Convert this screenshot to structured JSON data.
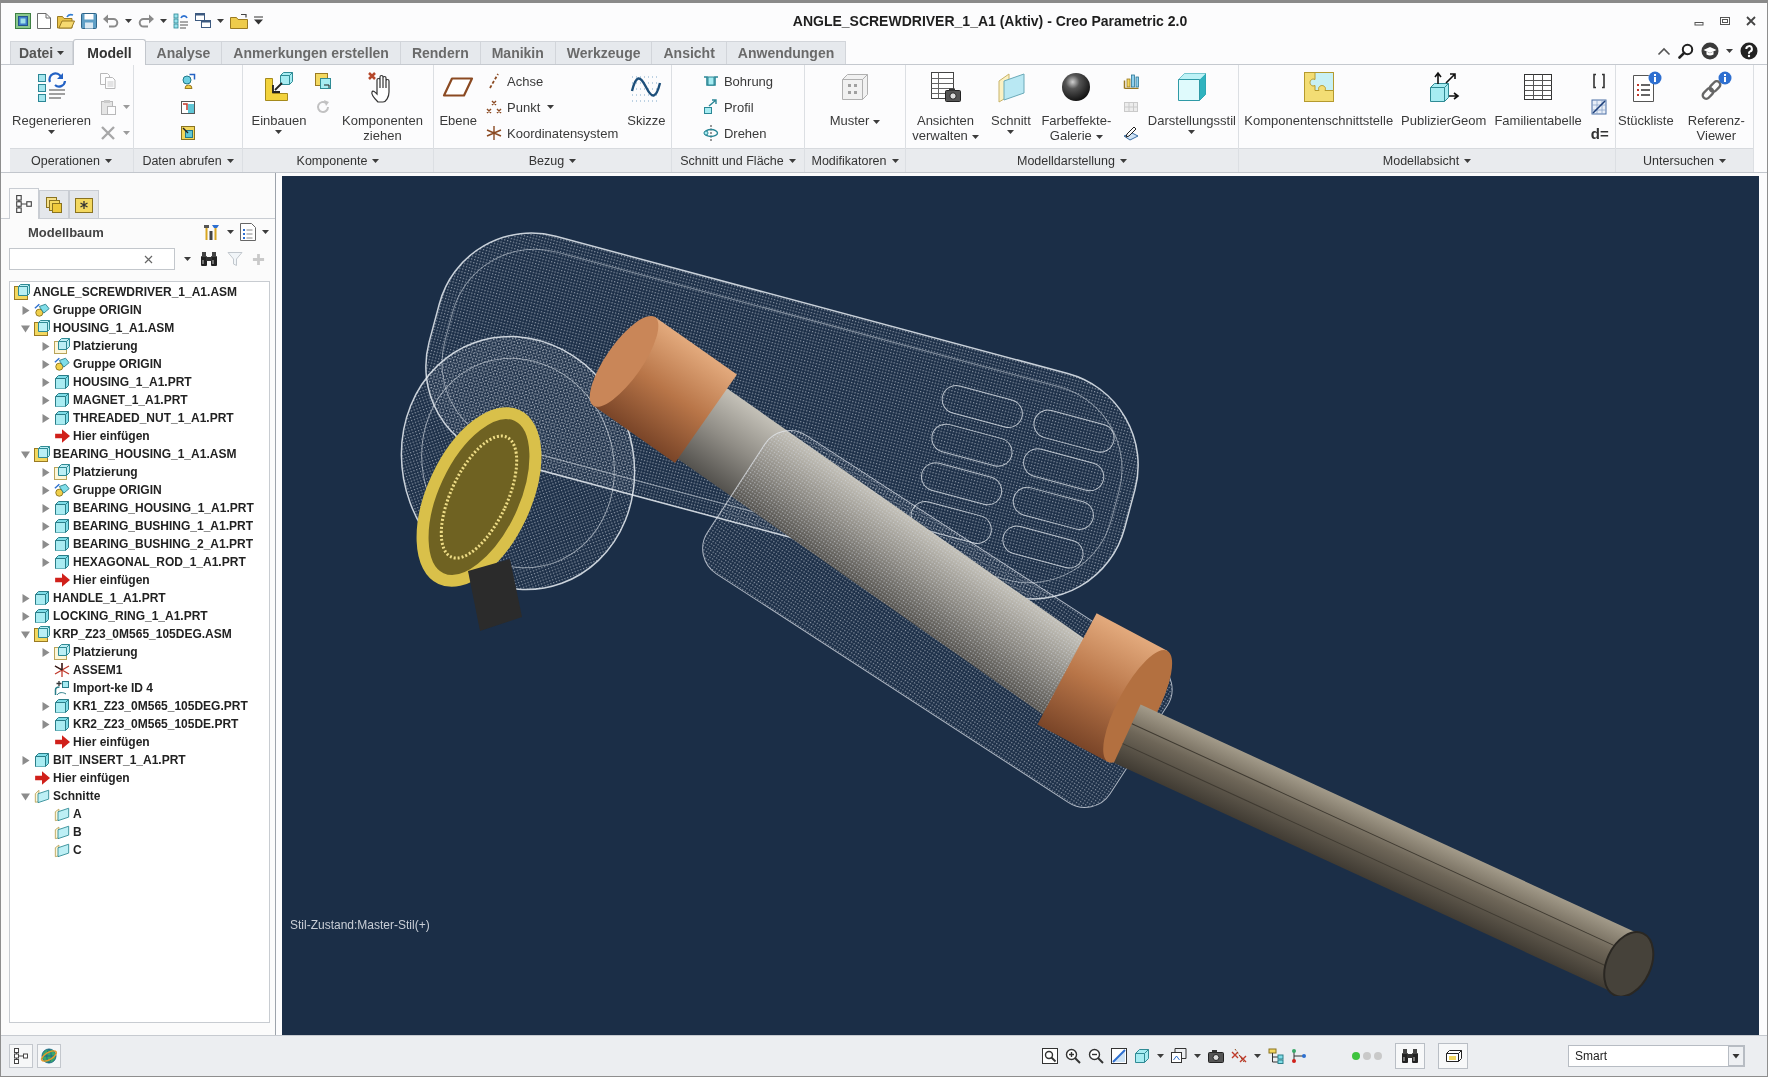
{
  "window": {
    "title": "ANGLE_SCREWDRIVER_1_A1 (Aktiv) - Creo Parametric 2.0"
  },
  "tabs": [
    {
      "label": "Datei",
      "kind": "file",
      "selected": false
    },
    {
      "label": "Modell",
      "kind": "tab",
      "selected": true
    },
    {
      "label": "Analyse",
      "kind": "tab",
      "selected": false
    },
    {
      "label": "Anmerkungen erstellen",
      "kind": "tab",
      "selected": false
    },
    {
      "label": "Rendern",
      "kind": "tab",
      "selected": false
    },
    {
      "label": "Manikin",
      "kind": "tab",
      "selected": false
    },
    {
      "label": "Werkzeuge",
      "kind": "tab",
      "selected": false
    },
    {
      "label": "Ansicht",
      "kind": "tab",
      "selected": false
    },
    {
      "label": "Anwendungen",
      "kind": "tab",
      "selected": false
    }
  ],
  "ribbon": {
    "groups": [
      {
        "label": "Operationen",
        "items": [
          {
            "kind": "split",
            "label": "Regenerieren"
          },
          {
            "kind": "stack",
            "items": [
              {
                "kind": "icon",
                "disabled": true
              },
              {
                "kind": "icon",
                "disabled": true,
                "dropdown": true
              },
              {
                "kind": "icon",
                "disabled": true,
                "dropdown": true
              }
            ]
          }
        ]
      },
      {
        "label": "Daten abrufen",
        "items": [
          {
            "kind": "stack",
            "items": [
              {
                "kind": "icon",
                "disabled": false
              },
              {
                "kind": "icon",
                "disabled": false
              },
              {
                "kind": "icon",
                "disabled": false
              }
            ]
          }
        ]
      },
      {
        "label": "Komponente",
        "items": [
          {
            "kind": "split",
            "label": "Einbauen"
          },
          {
            "kind": "stack",
            "items": [
              {
                "kind": "icon",
                "disabled": false
              },
              {
                "kind": "icon",
                "disabled": true
              }
            ]
          },
          {
            "kind": "large",
            "label": "Komponenten ziehen"
          }
        ]
      },
      {
        "label": "Bezug",
        "items": [
          {
            "kind": "large",
            "label": "Ebene"
          },
          {
            "kind": "stack",
            "items": [
              {
                "kind": "small",
                "label": "Achse"
              },
              {
                "kind": "small",
                "label": "Punkt",
                "dropdown": true
              },
              {
                "kind": "small",
                "label": "Koordinatensystem"
              }
            ]
          },
          {
            "kind": "large",
            "label": "Skizze"
          }
        ]
      },
      {
        "label": "Schnitt und Fläche",
        "items": [
          {
            "kind": "stack",
            "items": [
              {
                "kind": "small",
                "label": "Bohrung"
              },
              {
                "kind": "small",
                "label": "Profil"
              },
              {
                "kind": "small",
                "label": "Drehen"
              }
            ]
          }
        ]
      },
      {
        "label": "Modifikatoren",
        "items": [
          {
            "kind": "menu",
            "label": "Muster"
          }
        ]
      },
      {
        "label": "Modelldarstellung",
        "items": [
          {
            "kind": "menu",
            "label": "Ansichten verwalten"
          },
          {
            "kind": "split",
            "label": "Schnitt"
          },
          {
            "kind": "menu",
            "label": "Farbeffekte-Galerie"
          },
          {
            "kind": "stack",
            "items": [
              {
                "kind": "icon",
                "disabled": false
              },
              {
                "kind": "icon",
                "disabled": true
              },
              {
                "kind": "icon",
                "disabled": false
              }
            ]
          },
          {
            "kind": "split",
            "label": "Darstellungsstil"
          }
        ]
      },
      {
        "label": "Modellabsicht",
        "items": [
          {
            "kind": "large",
            "label": "Komponentenschnittstelle"
          },
          {
            "kind": "large",
            "label": "PublizierGeom"
          },
          {
            "kind": "large",
            "label": "Familientabelle"
          },
          {
            "kind": "stack",
            "items": [
              {
                "kind": "icon",
                "disabled": false
              },
              {
                "kind": "icon",
                "disabled": false
              },
              {
                "kind": "glyph",
                "label": "d="
              }
            ]
          }
        ]
      },
      {
        "label": "Untersuchen",
        "items": [
          {
            "kind": "large",
            "label": "Stückliste"
          },
          {
            "kind": "large",
            "label": "Referenz-Viewer"
          }
        ]
      }
    ]
  },
  "navigator": {
    "tabs": [
      {
        "selected": true
      },
      {
        "selected": false
      },
      {
        "selected": false
      }
    ],
    "title": "Modellbaum",
    "search_tools": [
      {
        "disabled": false
      },
      {
        "disabled": true
      },
      {
        "disabled": true
      }
    ],
    "tree": [
      {
        "label": "ANGLE_SCREWDRIVER_1_A1.ASM",
        "kind": "asm",
        "children": [
          {
            "label": "Gruppe ORIGIN",
            "kind": "group",
            "expanded": false
          },
          {
            "label": "HOUSING_1_A1.ASM",
            "kind": "asm",
            "expanded": true,
            "children": [
              {
                "label": "Platzierung",
                "kind": "placement",
                "expanded": false
              },
              {
                "label": "Gruppe ORIGIN",
                "kind": "group",
                "expanded": false
              },
              {
                "label": "HOUSING_1_A1.PRT",
                "kind": "prt",
                "expanded": false
              },
              {
                "label": "MAGNET_1_A1.PRT",
                "kind": "prt",
                "expanded": false
              },
              {
                "label": "THREADED_NUT_1_A1.PRT",
                "kind": "prt",
                "expanded": false
              },
              {
                "label": "Hier einfügen",
                "kind": "insert"
              }
            ]
          },
          {
            "label": "BEARING_HOUSING_1_A1.ASM",
            "kind": "asm",
            "expanded": true,
            "children": [
              {
                "label": "Platzierung",
                "kind": "placement",
                "expanded": false
              },
              {
                "label": "Gruppe ORIGIN",
                "kind": "group",
                "expanded": false
              },
              {
                "label": "BEARING_HOUSING_1_A1.PRT",
                "kind": "prt",
                "expanded": false
              },
              {
                "label": "BEARING_BUSHING_1_A1.PRT",
                "kind": "prt",
                "expanded": false
              },
              {
                "label": "BEARING_BUSHING_2_A1.PRT",
                "kind": "prt",
                "expanded": false
              },
              {
                "label": "HEXAGONAL_ROD_1_A1.PRT",
                "kind": "prt",
                "expanded": false
              },
              {
                "label": "Hier einfügen",
                "kind": "insert"
              }
            ]
          },
          {
            "label": "HANDLE_1_A1.PRT",
            "kind": "prt",
            "expanded": false
          },
          {
            "label": "LOCKING_RING_1_A1.PRT",
            "kind": "prt",
            "expanded": false
          },
          {
            "label": "KRP_Z23_0M565_105DEG.ASM",
            "kind": "asm",
            "expanded": true,
            "children": [
              {
                "label": "Platzierung",
                "kind": "placement",
                "expanded": false
              },
              {
                "label": "ASSEM1",
                "kind": "csys"
              },
              {
                "label": "Import-ke ID 4",
                "kind": "import"
              },
              {
                "label": "KR1_Z23_0M565_105DEG.PRT",
                "kind": "prt",
                "expanded": false
              },
              {
                "label": "KR2_Z23_0M565_105DE.PRT",
                "kind": "prt",
                "expanded": false
              },
              {
                "label": "Hier einfügen",
                "kind": "insert"
              }
            ]
          },
          {
            "label": "BIT_INSERT_1_A1.PRT",
            "kind": "prt",
            "expanded": false
          },
          {
            "label": "Hier einfügen",
            "kind": "insert"
          },
          {
            "label": "Schnitte",
            "kind": "sections",
            "expanded": true,
            "children": [
              {
                "label": "A",
                "kind": "section"
              },
              {
                "label": "B",
                "kind": "section"
              },
              {
                "label": "C",
                "kind": "section"
              }
            ]
          }
        ]
      }
    ]
  },
  "viewport": {
    "status_text": "Stil-Zustand:Master-Stil(+)"
  },
  "status_bar": {
    "lights": [
      {
        "color": "#3ec43e"
      },
      {
        "color": "#c9c9c9"
      },
      {
        "color": "#c9c9c9"
      }
    ],
    "selection_filter": "Smart"
  }
}
